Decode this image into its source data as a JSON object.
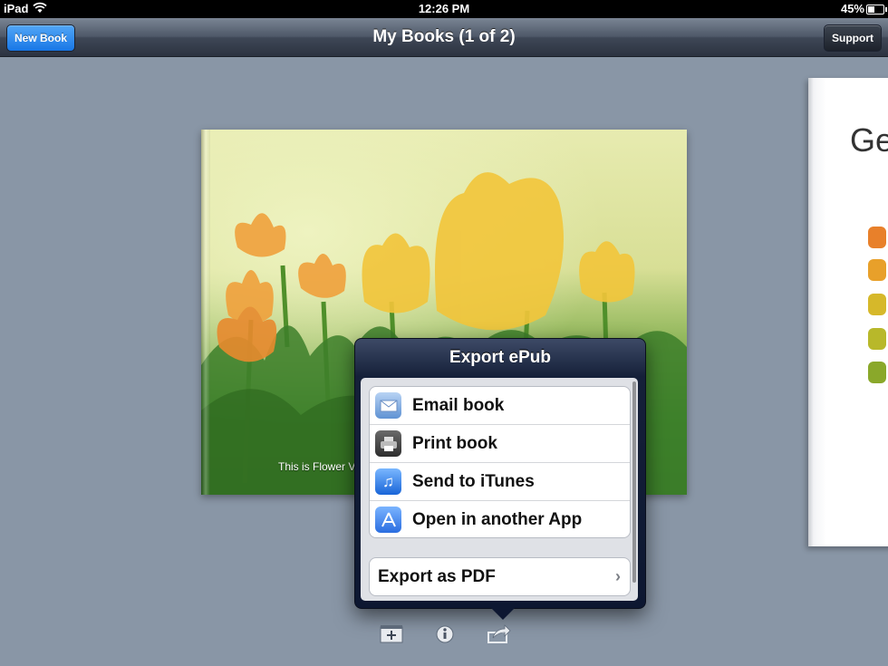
{
  "status_bar": {
    "device": "iPad",
    "time": "12:26 PM",
    "battery": "45%"
  },
  "nav_bar": {
    "title": "My Books (1 of 2)",
    "new_book_label": "New Book",
    "support_label": "Support"
  },
  "book": {
    "caption": "This is Flower V"
  },
  "second_book": {
    "heading": "Ge"
  },
  "popover": {
    "title": "Export ePub",
    "items": [
      {
        "label": "Email book",
        "icon": "mail-icon"
      },
      {
        "label": "Print book",
        "icon": "printer-icon"
      },
      {
        "label": "Send to iTunes",
        "icon": "music-note-icon"
      },
      {
        "label": "Open in another App",
        "icon": "app-store-icon"
      }
    ],
    "pdf_label": "Export as PDF"
  },
  "toolbar": {
    "icons": [
      "add-page-icon",
      "info-icon",
      "share-icon"
    ]
  },
  "colors": {
    "background": "#8996a6",
    "new_book_button": "#1877e6",
    "popover": "#0d1731"
  }
}
